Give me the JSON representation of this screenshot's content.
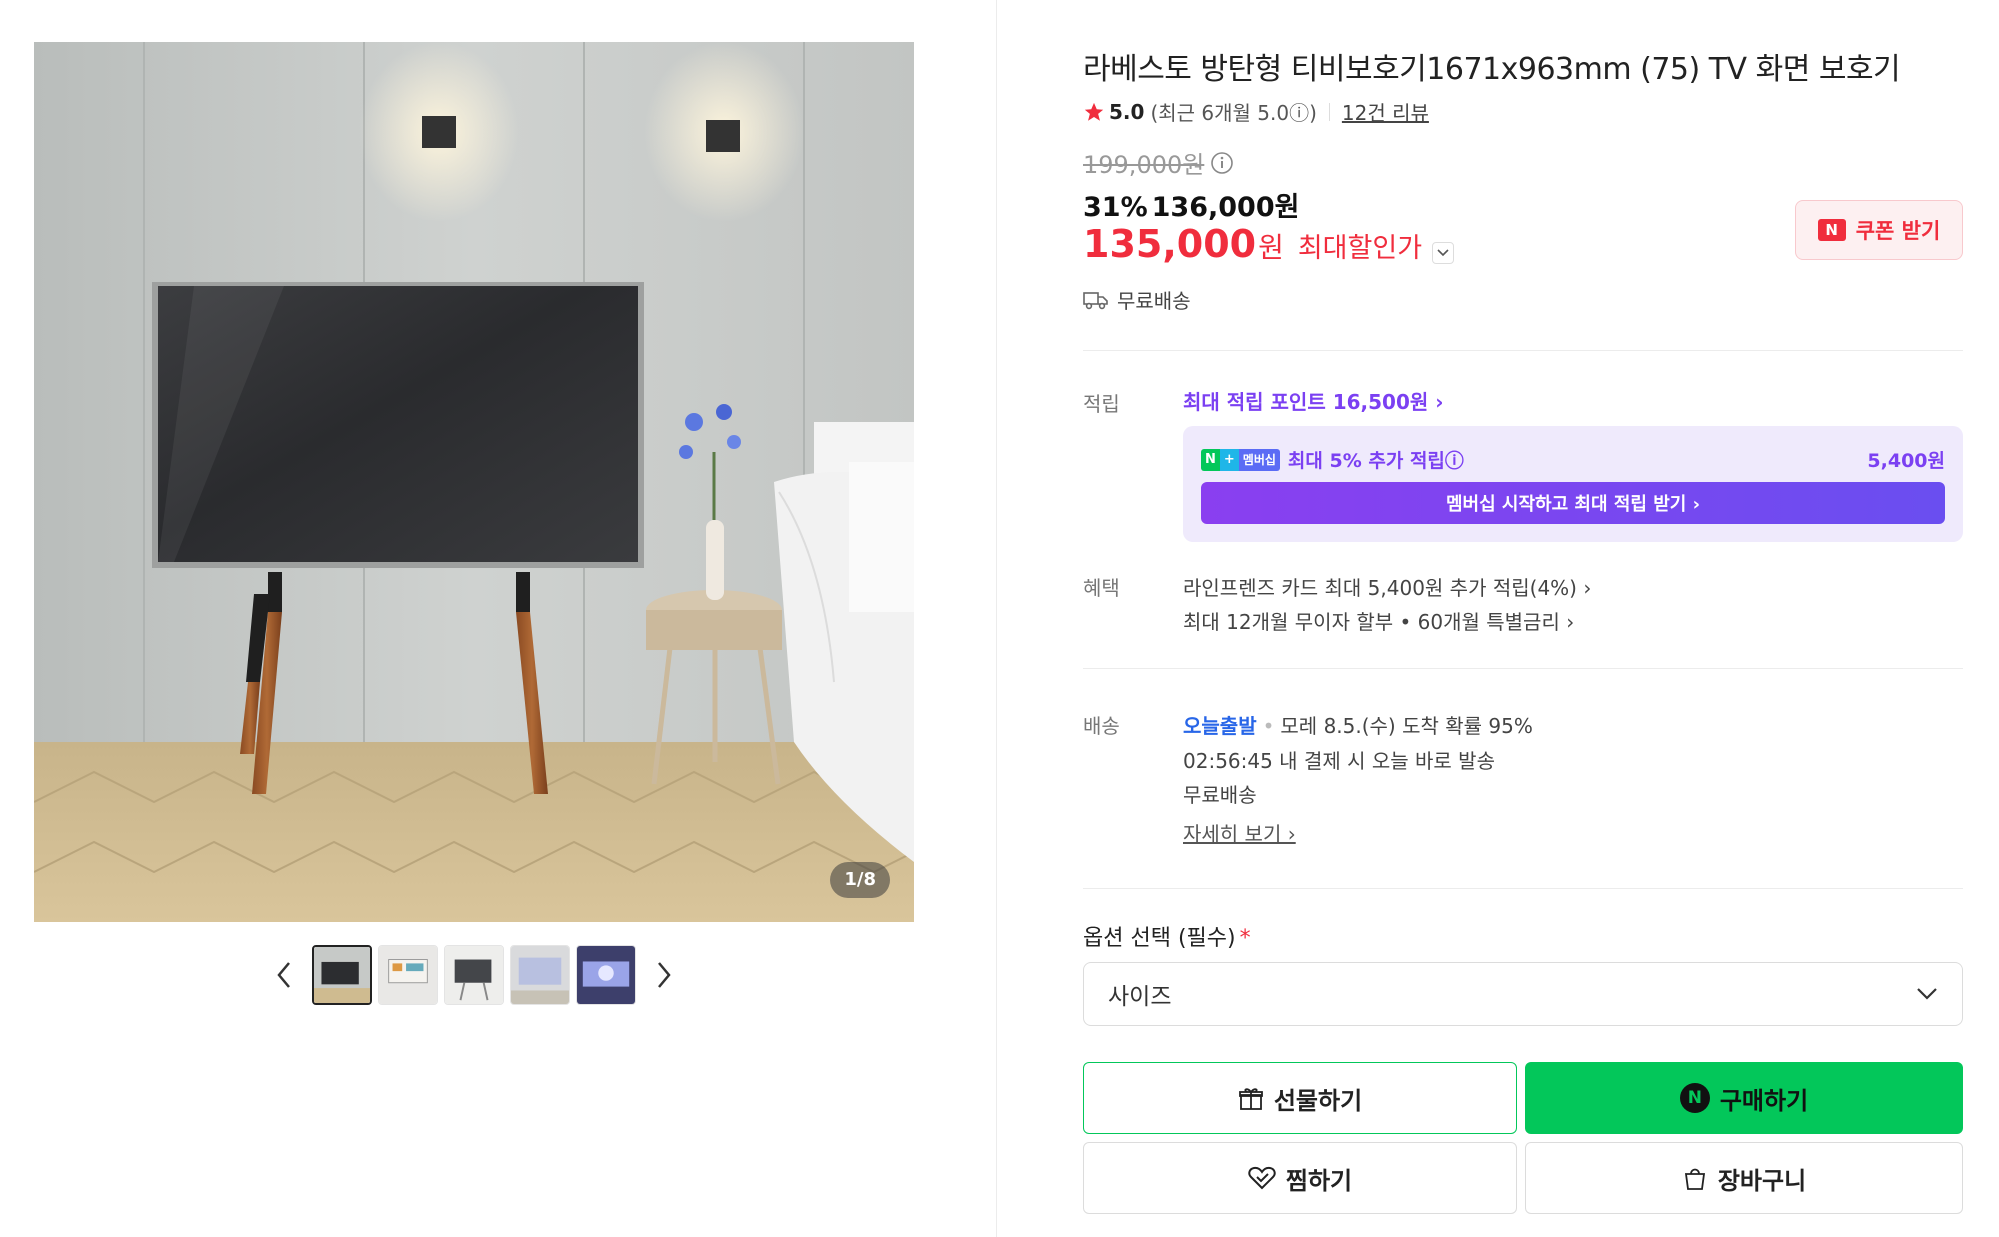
{
  "gallery": {
    "counter": "1/8",
    "thumbnails": [
      "thumb-1",
      "thumb-2",
      "thumb-3",
      "thumb-4",
      "thumb-5"
    ]
  },
  "product": {
    "title": "라베스토 방탄형 티비보호기1671x963mm (75) TV 화면 보호기",
    "rating": "5.0",
    "recent_rating": "(최근 6개월 5.0ⓘ)",
    "reviews": "12건 리뷰",
    "original_price": "199,000원",
    "discount_pct": "31%",
    "sale_price": "136,000원",
    "best_price_num": "135,000",
    "best_price_unit": "원",
    "best_price_label": "최대할인가",
    "free_shipping": "무료배송"
  },
  "coupon": {
    "label": "쿠폰 받기"
  },
  "points": {
    "label": "적립",
    "link": "최대 적립 포인트 16,500원 ›",
    "membership_text": "최대 5% 추가 적립ⓘ",
    "membership_badge": "멤버십",
    "membership_amount": "5,400원",
    "membership_button": "멤버십 시작하고 최대 적립 받기 ›"
  },
  "benefits": {
    "label": "혜택",
    "lines": [
      "라인프렌즈 카드 최대 5,400원 추가 적립(4%) ›",
      "최대 12개월 무이자 할부 • 60개월 특별금리 ›"
    ]
  },
  "delivery": {
    "label": "배송",
    "today_tag": "오늘출발",
    "arrival": "모레 8.5.(수) 도착 확률 95%",
    "cutoff": "02:56:45  내 결제 시 오늘 바로 발송",
    "free": "무료배송",
    "detail_link": "자세히 보기 ›"
  },
  "option": {
    "label": "옵션 선택 (필수)",
    "required_mark": "*",
    "placeholder": "사이즈"
  },
  "buttons": {
    "gift": "선물하기",
    "buy": "구매하기",
    "wish": "찜하기",
    "cart": "장바구니"
  },
  "colors": {
    "naver_green": "#03c75a",
    "sale_red": "#f02d3d",
    "membership_purple": "#7b40f2",
    "today_blue": "#2866e8"
  }
}
